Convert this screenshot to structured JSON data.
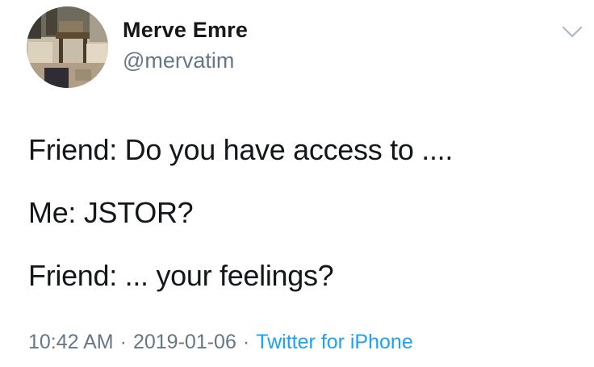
{
  "author": {
    "name": "Merve Emre",
    "handle": "@mervatim"
  },
  "tweet": {
    "lines": [
      "Friend: Do you have access to ....",
      "Me: JSTOR?",
      "Friend: ... your feelings?"
    ]
  },
  "meta": {
    "time": "10:42 AM",
    "date": "2019-01-06",
    "source": "Twitter for iPhone",
    "separator": "·"
  },
  "icons": {
    "menu": "chevron-down-icon"
  },
  "colors": {
    "text": "#14171a",
    "muted": "#657786",
    "link": "#1da1f2"
  }
}
